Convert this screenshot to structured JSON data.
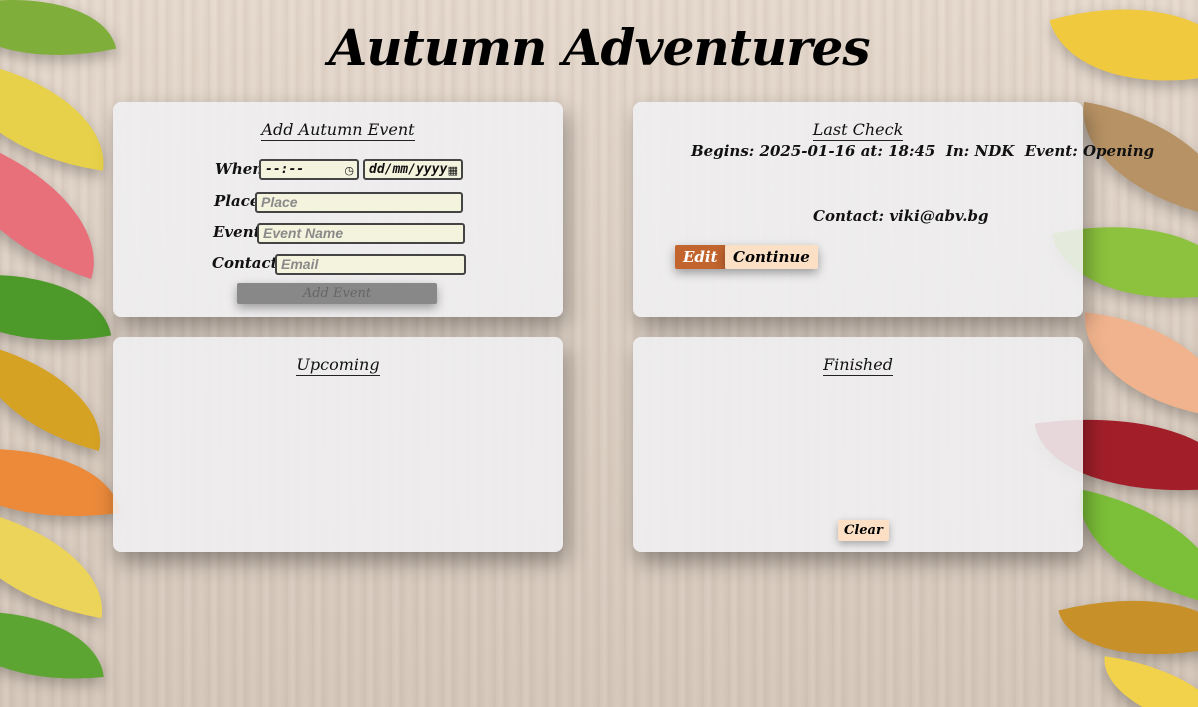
{
  "app": {
    "title": "Autumn Adventures"
  },
  "add_event": {
    "heading": "Add Autumn Event",
    "when_label": "When:",
    "time_placeholder": "--:--",
    "date_placeholder": "dd/mm/yyyy",
    "place_label": "Place:",
    "place_placeholder": "Place",
    "event_label": "Event:",
    "event_placeholder": "Event Name",
    "contacts_label": "Contacts:",
    "contacts_placeholder": "Email",
    "submit_label": "Add Event"
  },
  "last_check": {
    "heading": "Last Check",
    "details": "Begins: 2025-01-16 at: 18:45  In: NDK  Event: Opening",
    "contact": "Contact: viki@abv.bg",
    "edit_label": "Edit",
    "continue_label": "Continue"
  },
  "upcoming": {
    "heading": "Upcoming"
  },
  "finished": {
    "heading": "Finished",
    "clear_label": "Clear"
  },
  "colors": {
    "edit_button": "#c2642e",
    "light_button": "#fbe0c6",
    "input_bg": "#f4f3dd",
    "disabled_button": "#888888"
  },
  "icons": {
    "time": "clock-icon",
    "date": "calendar-icon"
  }
}
